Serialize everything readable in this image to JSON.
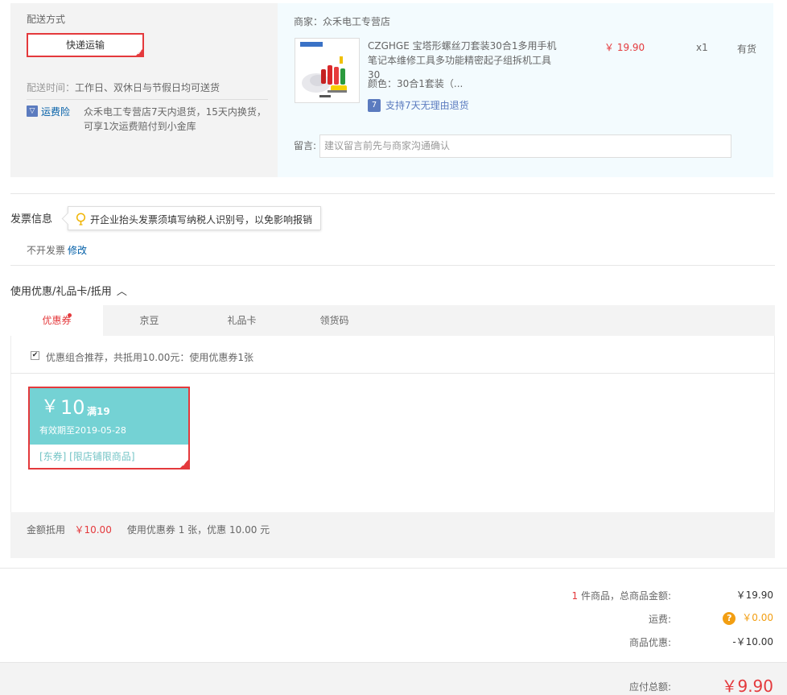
{
  "delivery": {
    "section_title": "配送方式",
    "selected_method": "快递运输",
    "time_label": "配送时间：",
    "time_value": "工作日、双休日与节假日均可送货",
    "insurance_icon": "shield-icon",
    "insurance_label": "运费险",
    "insurance_desc": "众禾电工专营店7天内退货，15天内换货，可享1次运费赔付到小金库"
  },
  "shop": {
    "seller": "商家：众禾电工专营店",
    "product_name": "CZGHGE 宝塔形螺丝刀套装30合1多用手机笔记本维修工具多功能精密起子组拆机工具 30",
    "product_attr": "颜色：30合1套装（...",
    "return_icon": "seven-day-return-icon",
    "return_text": "支持7天无理由退货",
    "price": "￥ 19.90",
    "qty": "x1",
    "stock": "有货",
    "message_label": "留言:",
    "message_placeholder": "建议留言前先与商家沟通确认"
  },
  "invoice": {
    "title": "发票信息",
    "tip": "开企业抬头发票须填写纳税人识别号，以免影响报销",
    "status": "不开发票",
    "edit_label": "修改"
  },
  "coupons": {
    "title": "使用优惠/礼品卡/抵用",
    "collapse_icon": "chevron-up-icon",
    "tabs": [
      {
        "label": "优惠券"
      },
      {
        "label": "京豆"
      },
      {
        "label": "礼品卡"
      },
      {
        "label": "领货码"
      }
    ],
    "combo_checked": true,
    "combo_text": "优惠组合推荐，共抵用10.00元：使用优惠券1张",
    "card": {
      "yen": "￥",
      "amount": "10",
      "condition": "满19",
      "expiry": "有效期至2019-05-28",
      "tags": "[东券]  [限店铺限商品]"
    },
    "summary_label": "金额抵用",
    "summary_amount": "￥10.00",
    "summary_detail": "使用优惠券 1 张，优惠 10.00 元"
  },
  "totals": {
    "count": "1",
    "count_suffix": " 件商品，总商品金额:",
    "goods_amount": "￥19.90",
    "freight_label": "运费:",
    "freight_icon": "question-icon",
    "freight_value": "￥0.00",
    "discount_label": "商品优惠:",
    "discount_value": "-￥10.00",
    "payable_label": "应付总额:",
    "payable_value": "￥9.90"
  },
  "colors": {
    "accent_red": "#e4393c",
    "link_blue": "#005ea7",
    "coupon_teal": "#74d2d4",
    "shop_bg": "#f3fbfe",
    "panel_bg": "#f3f3f3"
  }
}
